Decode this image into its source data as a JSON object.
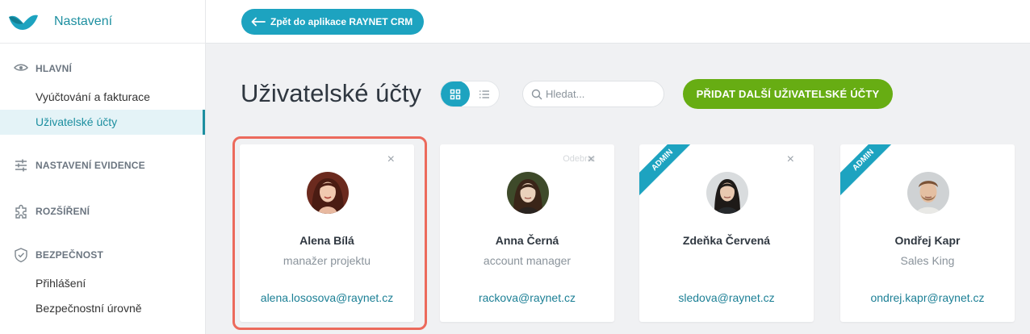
{
  "app": {
    "title": "Nastavení"
  },
  "sidebar": {
    "sections": [
      {
        "label": "HLAVNÍ",
        "icon": "eye-icon"
      },
      {
        "label": "NASTAVENÍ EVIDENCE",
        "icon": "sliders-icon"
      },
      {
        "label": "ROZŠÍŘENÍ",
        "icon": "puzzle-icon"
      },
      {
        "label": "BEZPEČNOST",
        "icon": "shield-icon"
      }
    ],
    "items": [
      {
        "label": "Vyúčtování a fakturace"
      },
      {
        "label": "Uživatelské účty",
        "active": true
      },
      {
        "label": "Přihlášení"
      },
      {
        "label": "Bezpečnostní úrovně"
      }
    ]
  },
  "topbar": {
    "back_label": "Zpět do aplikace RAYNET CRM"
  },
  "main": {
    "title": "Uživatelské účty",
    "search_placeholder": "Hledat...",
    "add_label": "PŘIDAT DALŠÍ UŽIVATELSKÉ ÚČTY",
    "view_modes": [
      "grid-icon",
      "list-icon"
    ]
  },
  "cards": [
    {
      "name": "Alena Bílá",
      "role": "manažer projektu",
      "email": "alena.lososova@raynet.cz",
      "admin": false,
      "selected": true
    },
    {
      "name": "Anna Černá",
      "role": "account manager",
      "email": "rackova@raynet.cz",
      "admin": false,
      "hint": "Odebrat"
    },
    {
      "name": "Zdeňka Červená",
      "role": "",
      "email": "sledova@raynet.cz",
      "admin": true
    },
    {
      "name": "Ondřej Kapr",
      "role": "Sales King",
      "email": "ondrej.kapr@raynet.cz",
      "admin": true
    }
  ],
  "badges": {
    "admin": "ADMIN"
  },
  "icons": {
    "close": "×"
  },
  "colors": {
    "accent": "#1da3c0",
    "primary_green": "#67ad13",
    "selection": "#ec6a5c",
    "link": "#1b7f95"
  }
}
